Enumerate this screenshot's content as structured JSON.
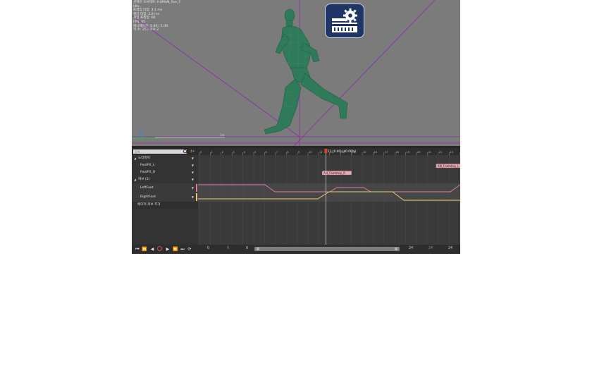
{
  "viewport": {
    "stats_lines": [
      "선택된 오브젝트: HUMAN_Run_F",
      "Idle…",
      "프레임 타임: 3.1 ms",
      "렌더 타임: 2.8 ms",
      "게임 프레임: 60",
      "FPS: 60",
      "애니메이션: 0.40 / 1.00",
      "키 수: 25 / 커브 2"
    ],
    "settings_button_icon": "gear-toolbar-icon"
  },
  "track_panel": {
    "search_placeholder": "검색...",
    "filter_label": "‡+",
    "notifies_group": "노티파이",
    "notify_tracks": [
      "FootFX_L",
      "FootFX_R"
    ],
    "curves_group": "커브 (2)",
    "curve_tracks": [
      {
        "name": "LeftFoot",
        "color": "#e07aa8"
      },
      {
        "name": "RightFoot",
        "color": "#e8d06a"
      }
    ],
    "add_curve_label": "에디터 커브 추가"
  },
  "transport": {
    "to_start": "⏮",
    "prev_key": "⏪",
    "play_reverse": "◀",
    "play": "▶",
    "next_key": "⏩",
    "to_end": "⏭",
    "loop": "⟳"
  },
  "timeline": {
    "playhead_label": "11 (0.40) (40.00%)",
    "ruler_ticks": [
      "0",
      "1",
      "2",
      "3",
      "4",
      "5",
      "6",
      "7",
      "8",
      "9",
      "10",
      "11",
      "12",
      "13",
      "14",
      "15",
      "16",
      "17",
      "18",
      "19",
      "20",
      "21",
      "22",
      "23",
      "24"
    ],
    "events": [
      {
        "label": "AN_Footstep_R",
        "frame": 11.3
      },
      {
        "label": "AN_Footstep_L",
        "frame": 21.8
      }
    ],
    "bottom_numbers": [
      "0",
      "0",
      "0",
      "24",
      "24",
      "24"
    ],
    "total_frames": 24,
    "playhead_frame": 11
  }
}
